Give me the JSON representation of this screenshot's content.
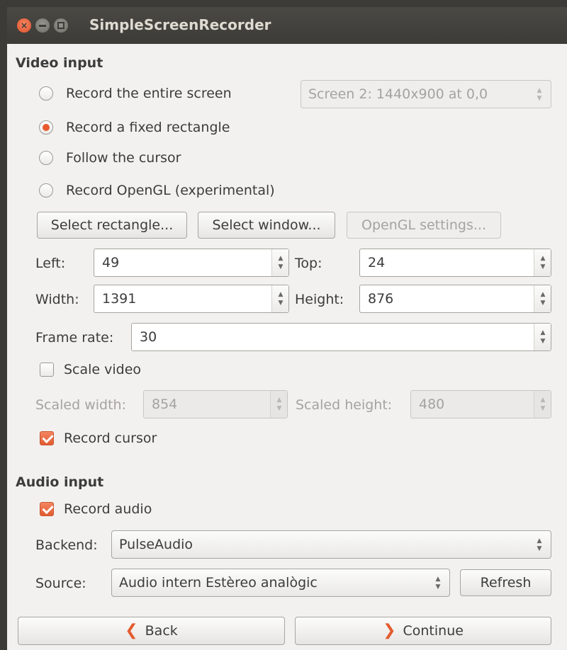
{
  "window": {
    "title": "SimpleScreenRecorder"
  },
  "video_input": {
    "heading": "Video input",
    "options": {
      "entire_screen": "Record the entire screen",
      "fixed_rectangle": "Record a fixed rectangle",
      "follow_cursor": "Follow the cursor",
      "opengl": "Record OpenGL (experimental)"
    },
    "selected_option": "fixed_rectangle",
    "screen_select": "Screen 2: 1440x900 at 0,0",
    "buttons": {
      "select_rectangle": "Select rectangle...",
      "select_window": "Select window...",
      "opengl_settings": "OpenGL settings..."
    },
    "left_label": "Left:",
    "left_value": "49",
    "top_label": "Top:",
    "top_value": "24",
    "width_label": "Width:",
    "width_value": "1391",
    "height_label": "Height:",
    "height_value": "876",
    "frame_rate_label": "Frame rate:",
    "frame_rate_value": "30",
    "scale_video_label": "Scale video",
    "scale_video_checked": false,
    "scaled_width_label": "Scaled width:",
    "scaled_width_value": "854",
    "scaled_height_label": "Scaled height:",
    "scaled_height_value": "480",
    "record_cursor_label": "Record cursor",
    "record_cursor_checked": true
  },
  "audio_input": {
    "heading": "Audio input",
    "record_audio_label": "Record audio",
    "record_audio_checked": true,
    "backend_label": "Backend:",
    "backend_value": "PulseAudio",
    "source_label": "Source:",
    "source_value": "Audio intern Estèreo analògic",
    "refresh_label": "Refresh"
  },
  "footer": {
    "back_label": "Back",
    "continue_label": "Continue"
  },
  "colors": {
    "accent": "#e9592d",
    "titlebar": "#3c3b37",
    "background": "#f2f1f0"
  }
}
